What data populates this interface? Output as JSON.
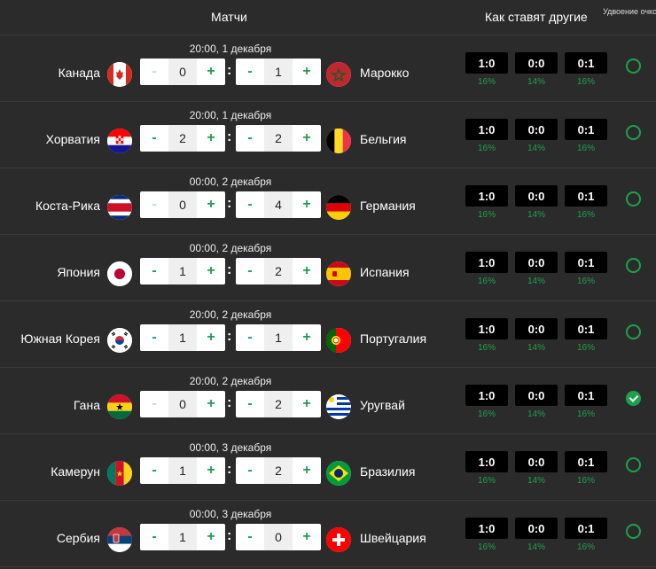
{
  "header": {
    "matches": "Матчи",
    "others": "Как ставят другие",
    "double": "Удвоение очков"
  },
  "controls": {
    "minus": "-",
    "plus": "+",
    "colon": ":"
  },
  "matches": [
    {
      "datetime": "20:00, 1 декабря",
      "home": "Канада",
      "home_flag": "canada-flag-icon",
      "home_score": "0",
      "home_minus_disabled": true,
      "away": "Марокко",
      "away_flag": "morocco-flag-icon",
      "away_score": "1",
      "away_minus_disabled": false,
      "picks": [
        {
          "score": "1:0",
          "pct": "16%"
        },
        {
          "score": "0:0",
          "pct": "14%"
        },
        {
          "score": "0:1",
          "pct": "16%"
        }
      ],
      "double": false
    },
    {
      "datetime": "20:00, 1 декабря",
      "home": "Хорватия",
      "home_flag": "croatia-flag-icon",
      "home_score": "2",
      "home_minus_disabled": false,
      "away": "Бельгия",
      "away_flag": "belgium-flag-icon",
      "away_score": "2",
      "away_minus_disabled": false,
      "picks": [
        {
          "score": "1:0",
          "pct": "16%"
        },
        {
          "score": "0:0",
          "pct": "14%"
        },
        {
          "score": "0:1",
          "pct": "16%"
        }
      ],
      "double": false
    },
    {
      "datetime": "00:00, 2 декабря",
      "home": "Коста-Рика",
      "home_flag": "costa-rica-flag-icon",
      "home_score": "0",
      "home_minus_disabled": true,
      "away": "Германия",
      "away_flag": "germany-flag-icon",
      "away_score": "4",
      "away_minus_disabled": false,
      "picks": [
        {
          "score": "1:0",
          "pct": "16%"
        },
        {
          "score": "0:0",
          "pct": "14%"
        },
        {
          "score": "0:1",
          "pct": "16%"
        }
      ],
      "double": false
    },
    {
      "datetime": "00:00, 2 декабря",
      "home": "Япония",
      "home_flag": "japan-flag-icon",
      "home_score": "1",
      "home_minus_disabled": false,
      "away": "Испания",
      "away_flag": "spain-flag-icon",
      "away_score": "2",
      "away_minus_disabled": false,
      "picks": [
        {
          "score": "1:0",
          "pct": "16%"
        },
        {
          "score": "0:0",
          "pct": "14%"
        },
        {
          "score": "0:1",
          "pct": "16%"
        }
      ],
      "double": false
    },
    {
      "datetime": "20:00, 2 декабря",
      "home": "Южная Корея",
      "home_flag": "south-korea-flag-icon",
      "home_score": "1",
      "home_minus_disabled": false,
      "away": "Португалия",
      "away_flag": "portugal-flag-icon",
      "away_score": "1",
      "away_minus_disabled": false,
      "picks": [
        {
          "score": "1:0",
          "pct": "16%"
        },
        {
          "score": "0:0",
          "pct": "14%"
        },
        {
          "score": "0:1",
          "pct": "16%"
        }
      ],
      "double": false
    },
    {
      "datetime": "20:00, 2 декабря",
      "home": "Гана",
      "home_flag": "ghana-flag-icon",
      "home_score": "0",
      "home_minus_disabled": true,
      "away": "Уругвай",
      "away_flag": "uruguay-flag-icon",
      "away_score": "2",
      "away_minus_disabled": false,
      "picks": [
        {
          "score": "1:0",
          "pct": "16%"
        },
        {
          "score": "0:0",
          "pct": "14%"
        },
        {
          "score": "0:1",
          "pct": "16%"
        }
      ],
      "double": true
    },
    {
      "datetime": "00:00, 3 декабря",
      "home": "Камерун",
      "home_flag": "cameroon-flag-icon",
      "home_score": "1",
      "home_minus_disabled": false,
      "away": "Бразилия",
      "away_flag": "brazil-flag-icon",
      "away_score": "2",
      "away_minus_disabled": false,
      "picks": [
        {
          "score": "1:0",
          "pct": "16%"
        },
        {
          "score": "0:0",
          "pct": "14%"
        },
        {
          "score": "0:1",
          "pct": "16%"
        }
      ],
      "double": false
    },
    {
      "datetime": "00:00, 3 декабря",
      "home": "Сербия",
      "home_flag": "serbia-flag-icon",
      "home_score": "1",
      "home_minus_disabled": false,
      "away": "Швейцария",
      "away_flag": "switzerland-flag-icon",
      "away_score": "0",
      "away_minus_disabled": false,
      "picks": [
        {
          "score": "1:0",
          "pct": "16%"
        },
        {
          "score": "0:0",
          "pct": "14%"
        },
        {
          "score": "0:1",
          "pct": "16%"
        }
      ],
      "double": false
    }
  ],
  "colors": {
    "background": "#2b2b2b",
    "accent": "#1ca24a",
    "pick_bg": "#000000"
  }
}
